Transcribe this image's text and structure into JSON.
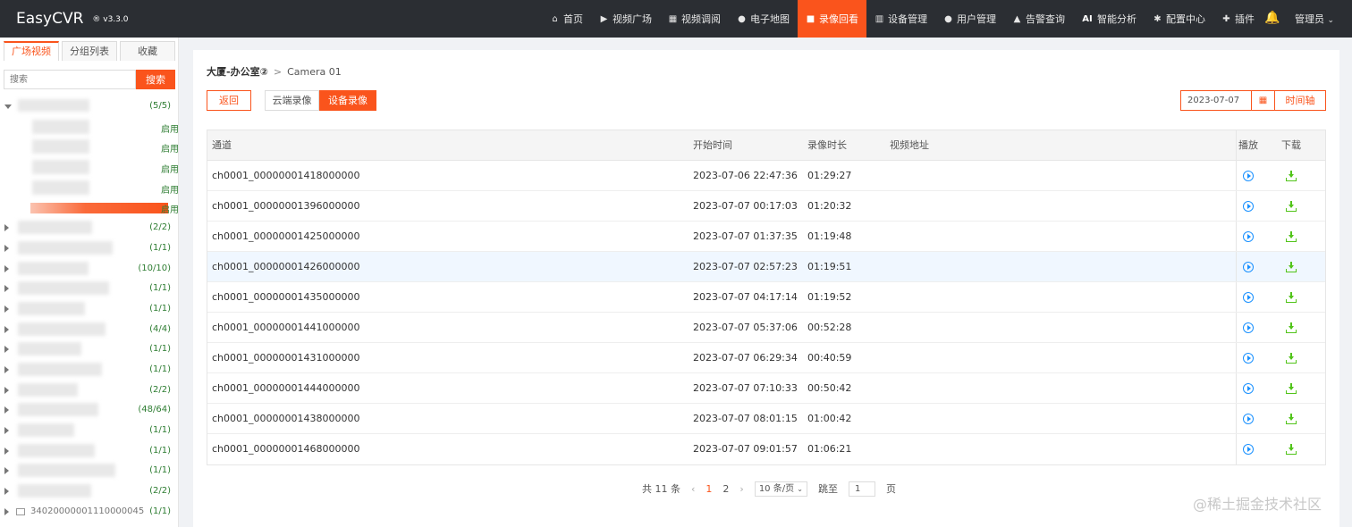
{
  "app": {
    "logo": "EasyCVR",
    "version": "® v3.3.0"
  },
  "nav": [
    {
      "label": "首页",
      "icon": "home-icon",
      "glyph": "⌂"
    },
    {
      "label": "视频广场",
      "icon": "play-circle-icon",
      "glyph": "▶"
    },
    {
      "label": "视频调阅",
      "icon": "grid-icon",
      "glyph": "▦"
    },
    {
      "label": "电子地图",
      "icon": "location-icon",
      "glyph": "●"
    },
    {
      "label": "录像回看",
      "icon": "video-camera-icon",
      "glyph": "■"
    },
    {
      "label": "设备管理",
      "icon": "device-icon",
      "glyph": "▥"
    },
    {
      "label": "用户管理",
      "icon": "user-icon",
      "glyph": "●"
    },
    {
      "label": "告警查询",
      "icon": "alarm-icon",
      "glyph": "▲"
    },
    {
      "label": "智能分析",
      "icon": "ai-icon",
      "glyph": "AI"
    },
    {
      "label": "配置中心",
      "icon": "gear-icon",
      "glyph": "✱"
    },
    {
      "label": "插件",
      "icon": "puzzle-icon",
      "glyph": "✚"
    }
  ],
  "header": {
    "user": "管理员",
    "user_caret": "⌄"
  },
  "sidebar": {
    "tabs": [
      "广场视频",
      "分组列表",
      "收藏"
    ],
    "search_placeholder": "搜索",
    "search_button": "搜索",
    "tree_counts": [
      "(5/5)",
      "(2/2)",
      "(1/1)",
      "(10/10)",
      "(1/1)",
      "(1/1)",
      "(4/4)",
      "(1/1)",
      "(1/1)",
      "(2/2)",
      "(48/64)",
      "(1/1)",
      "(1/1)",
      "(1/1)",
      "(2/2)",
      "(1/1)"
    ],
    "child_status": [
      "启用",
      "启用",
      "启用",
      "启用",
      "启用"
    ],
    "last_item_label": "34020000001110000045"
  },
  "breadcrumb": {
    "parent": "大厦-办公室②",
    "separator": ">",
    "current": "Camera 01"
  },
  "toolbar": {
    "back": "返回",
    "cloud": "云端录像",
    "device": "设备录像",
    "date": "2023-07-07",
    "timeline": "时间轴"
  },
  "table": {
    "headers": {
      "channel": "通道",
      "start": "开始时间",
      "duration": "录像时长",
      "url": "视频地址",
      "play": "播放",
      "download": "下载"
    },
    "rows": [
      {
        "channel": "ch0001_00000001418000000",
        "start": "2023-07-06 22:47:36",
        "duration": "01:29:27"
      },
      {
        "channel": "ch0001_00000001396000000",
        "start": "2023-07-07 00:17:03",
        "duration": "01:20:32"
      },
      {
        "channel": "ch0001_00000001425000000",
        "start": "2023-07-07 01:37:35",
        "duration": "01:19:48"
      },
      {
        "channel": "ch0001_00000001426000000",
        "start": "2023-07-07 02:57:23",
        "duration": "01:19:51"
      },
      {
        "channel": "ch0001_00000001435000000",
        "start": "2023-07-07 04:17:14",
        "duration": "01:19:52"
      },
      {
        "channel": "ch0001_00000001441000000",
        "start": "2023-07-07 05:37:06",
        "duration": "00:52:28"
      },
      {
        "channel": "ch0001_00000001431000000",
        "start": "2023-07-07 06:29:34",
        "duration": "00:40:59"
      },
      {
        "channel": "ch0001_00000001444000000",
        "start": "2023-07-07 07:10:33",
        "duration": "00:50:42"
      },
      {
        "channel": "ch0001_00000001438000000",
        "start": "2023-07-07 08:01:15",
        "duration": "01:00:42"
      },
      {
        "channel": "ch0001_00000001468000000",
        "start": "2023-07-07 09:01:57",
        "duration": "01:06:21"
      }
    ]
  },
  "pagination": {
    "total": "共 11 条",
    "prev": "‹",
    "pages": [
      "1",
      "2"
    ],
    "next": "›",
    "page_size": "10 条/页",
    "goto_label": "跳至",
    "goto_value": "1",
    "page_unit": "页"
  },
  "watermark": "@稀土掘金技术社区",
  "colors": {
    "accent": "#fa541c",
    "topbar": "#2b2e33",
    "play": "#1890ff",
    "download": "#52c41a",
    "count": "#2e7d32"
  }
}
